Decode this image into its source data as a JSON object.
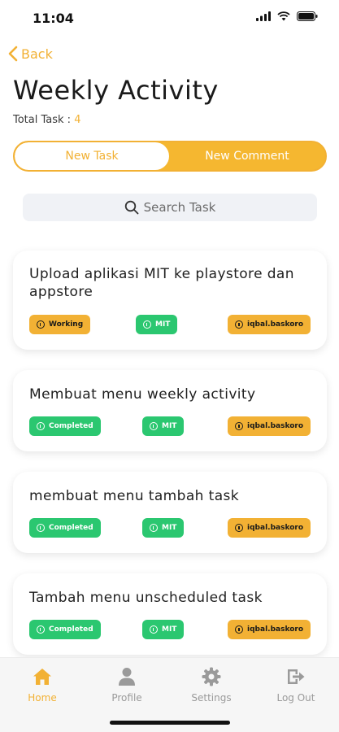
{
  "status_bar": {
    "time": "11:04"
  },
  "header": {
    "back_label": "Back",
    "title": "Weekly Activity",
    "total_label": "Total Task : ",
    "total_count": "4"
  },
  "segments": [
    {
      "label": "New Task",
      "active": true
    },
    {
      "label": "New Comment",
      "active": false
    }
  ],
  "search": {
    "placeholder": "Search Task"
  },
  "tasks": [
    {
      "title": "Upload aplikasi MIT ke playstore dan appstore",
      "status": "Working",
      "project": "MIT",
      "assignee": "iqbal.baskoro"
    },
    {
      "title": "Membuat menu weekly activity",
      "status": "Completed",
      "project": "MIT",
      "assignee": "iqbal.baskoro"
    },
    {
      "title": "membuat menu tambah task",
      "status": "Completed",
      "project": "MIT",
      "assignee": "iqbal.baskoro"
    },
    {
      "title": "Tambah menu unscheduled task",
      "status": "Completed",
      "project": "MIT",
      "assignee": "iqbal.baskoro"
    }
  ],
  "nav": [
    {
      "label": "Home",
      "icon": "home-icon",
      "active": true
    },
    {
      "label": "Profile",
      "icon": "person-icon",
      "active": false
    },
    {
      "label": "Settings",
      "icon": "gear-icon",
      "active": false
    },
    {
      "label": "Log Out",
      "icon": "logout-icon",
      "active": false
    }
  ],
  "colors": {
    "accent": "#f2b134",
    "completed": "#2bc770",
    "working": "#f2b134"
  }
}
